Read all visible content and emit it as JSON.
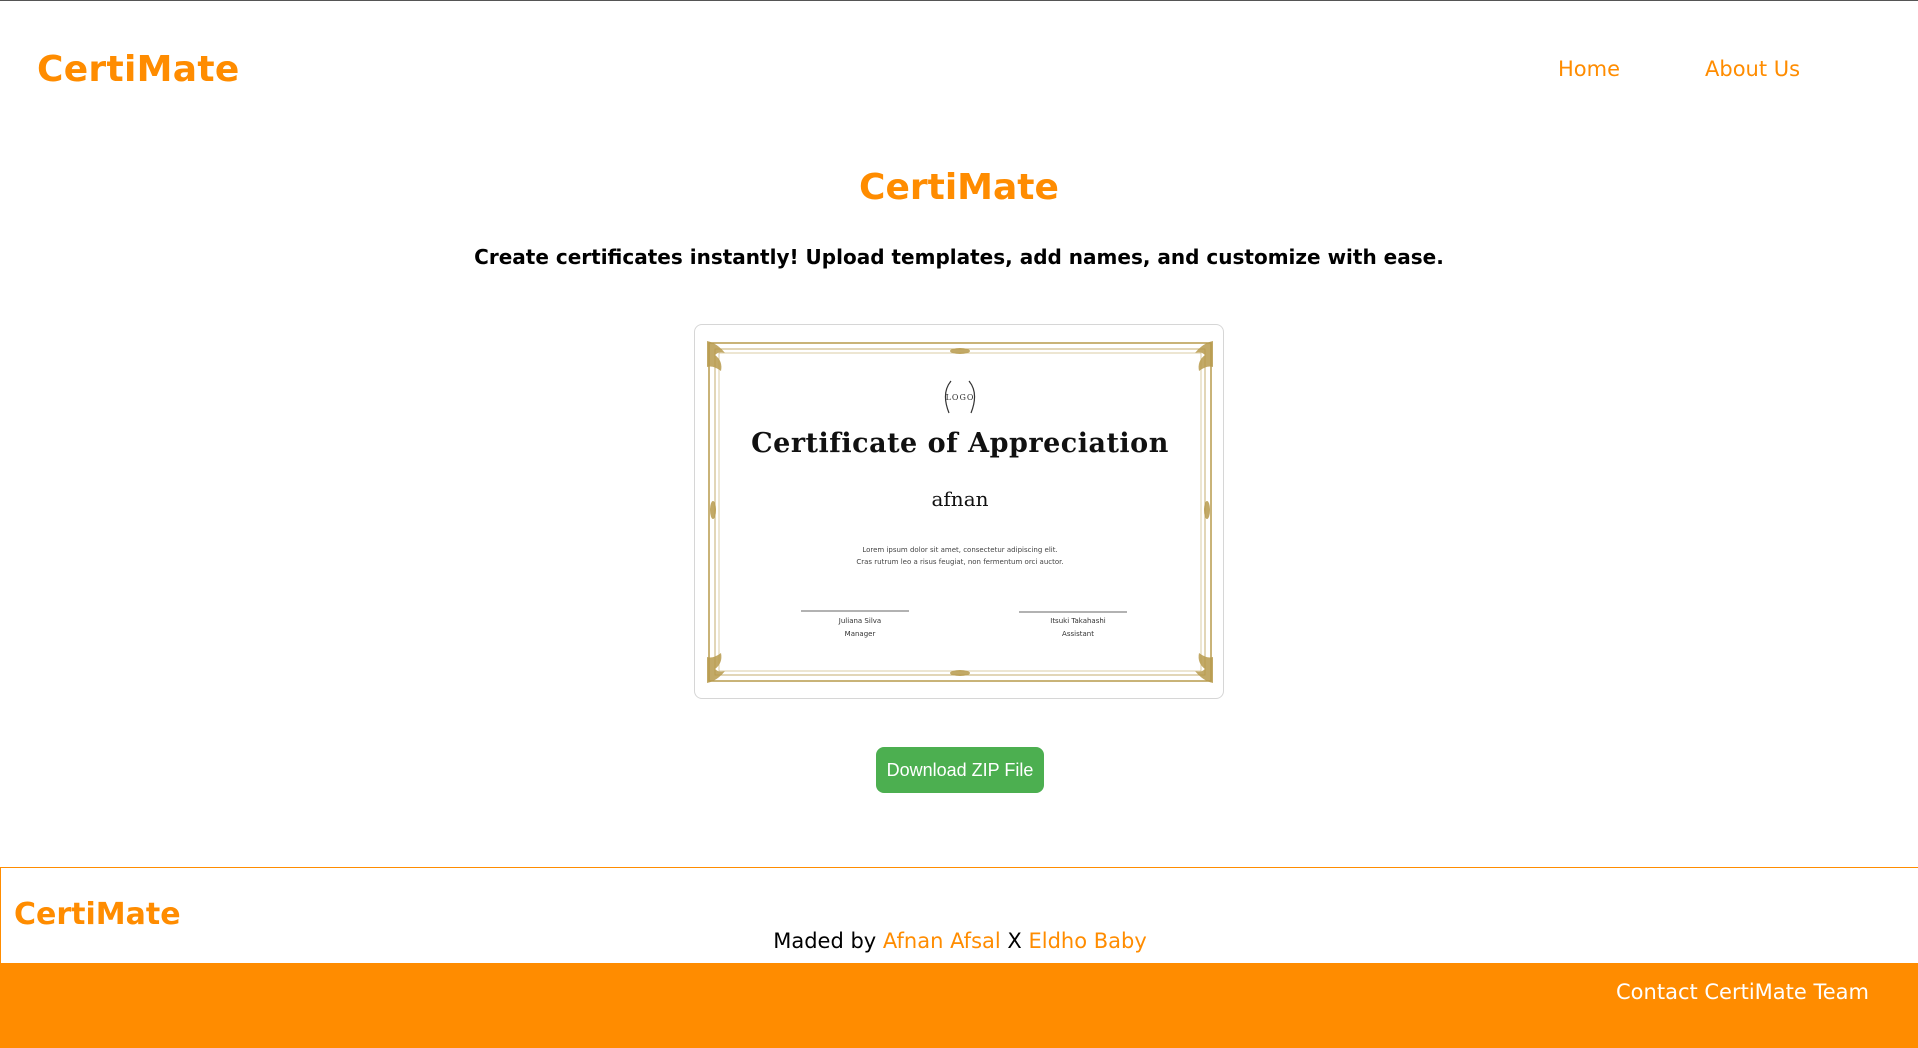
{
  "header": {
    "brand": "CertiMate",
    "nav": {
      "home": "Home",
      "about": "About Us"
    }
  },
  "hero": {
    "title": "CertiMate",
    "subtitle": "Create certificates instantly! Upload templates, add names, and customize with ease."
  },
  "certificate": {
    "logo_text": "LOGO",
    "title": "Certificate of Appreciation",
    "recipient": "afnan",
    "body_line1": "Lorem ipsum dolor sit amet, consectetur adipiscing elit.",
    "body_line2": "Cras rutrum leo a risus feugiat, non fermentum orci auctor.",
    "signatories": [
      {
        "name": "Juliana Silva",
        "role": "Manager"
      },
      {
        "name": "Itsuki Takahashi",
        "role": "Assistant"
      }
    ],
    "border_color": "#b79a4c"
  },
  "actions": {
    "download_label": "Download ZIP File"
  },
  "footer": {
    "brand": "CertiMate",
    "credits_prefix": "Maded by ",
    "author1": "Afnan Afsal",
    "separator": " X ",
    "author2": "Eldho Baby",
    "contact": "Contact CertiMate Team"
  },
  "colors": {
    "accent": "#ff8c00",
    "button": "#4caf50"
  }
}
